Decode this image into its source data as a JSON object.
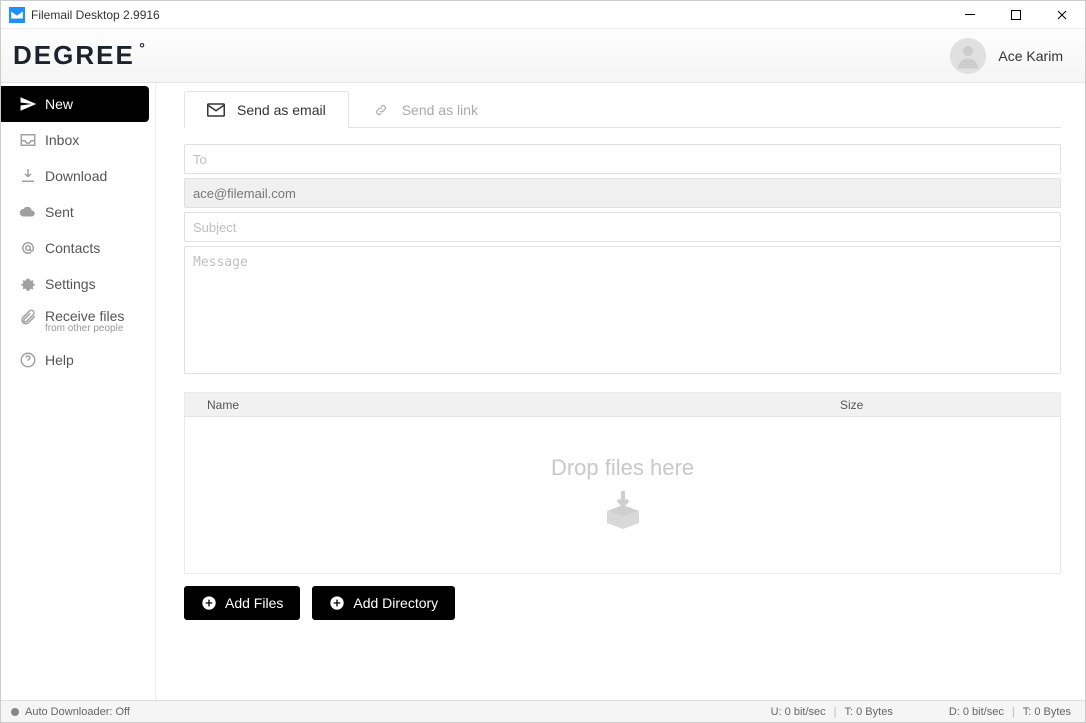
{
  "titlebar": {
    "title": "Filemail Desktop 2.9916"
  },
  "header": {
    "logo_text": "DEGREE",
    "username": "Ace Karim"
  },
  "sidebar": {
    "items": [
      {
        "label": "New"
      },
      {
        "label": "Inbox"
      },
      {
        "label": "Download"
      },
      {
        "label": "Sent"
      },
      {
        "label": "Contacts"
      },
      {
        "label": "Settings"
      },
      {
        "label": "Receive files",
        "sub": "from other people"
      },
      {
        "label": "Help"
      }
    ]
  },
  "tabs": {
    "email": "Send as email",
    "link": "Send as link"
  },
  "form": {
    "to_placeholder": "To",
    "from_value": "ace@filemail.com",
    "subject_placeholder": "Subject",
    "message_placeholder": "Message"
  },
  "filezone": {
    "col_name": "Name",
    "col_size": "Size",
    "drop_text": "Drop files here"
  },
  "buttons": {
    "add_files": "Add Files",
    "add_directory": "Add Directory"
  },
  "statusbar": {
    "auto_downloader": "Auto Downloader: Off",
    "upload_rate": "U: 0 bit/sec",
    "upload_total": "T: 0 Bytes",
    "download_rate": "D: 0 bit/sec",
    "download_total": "T: 0 Bytes"
  }
}
